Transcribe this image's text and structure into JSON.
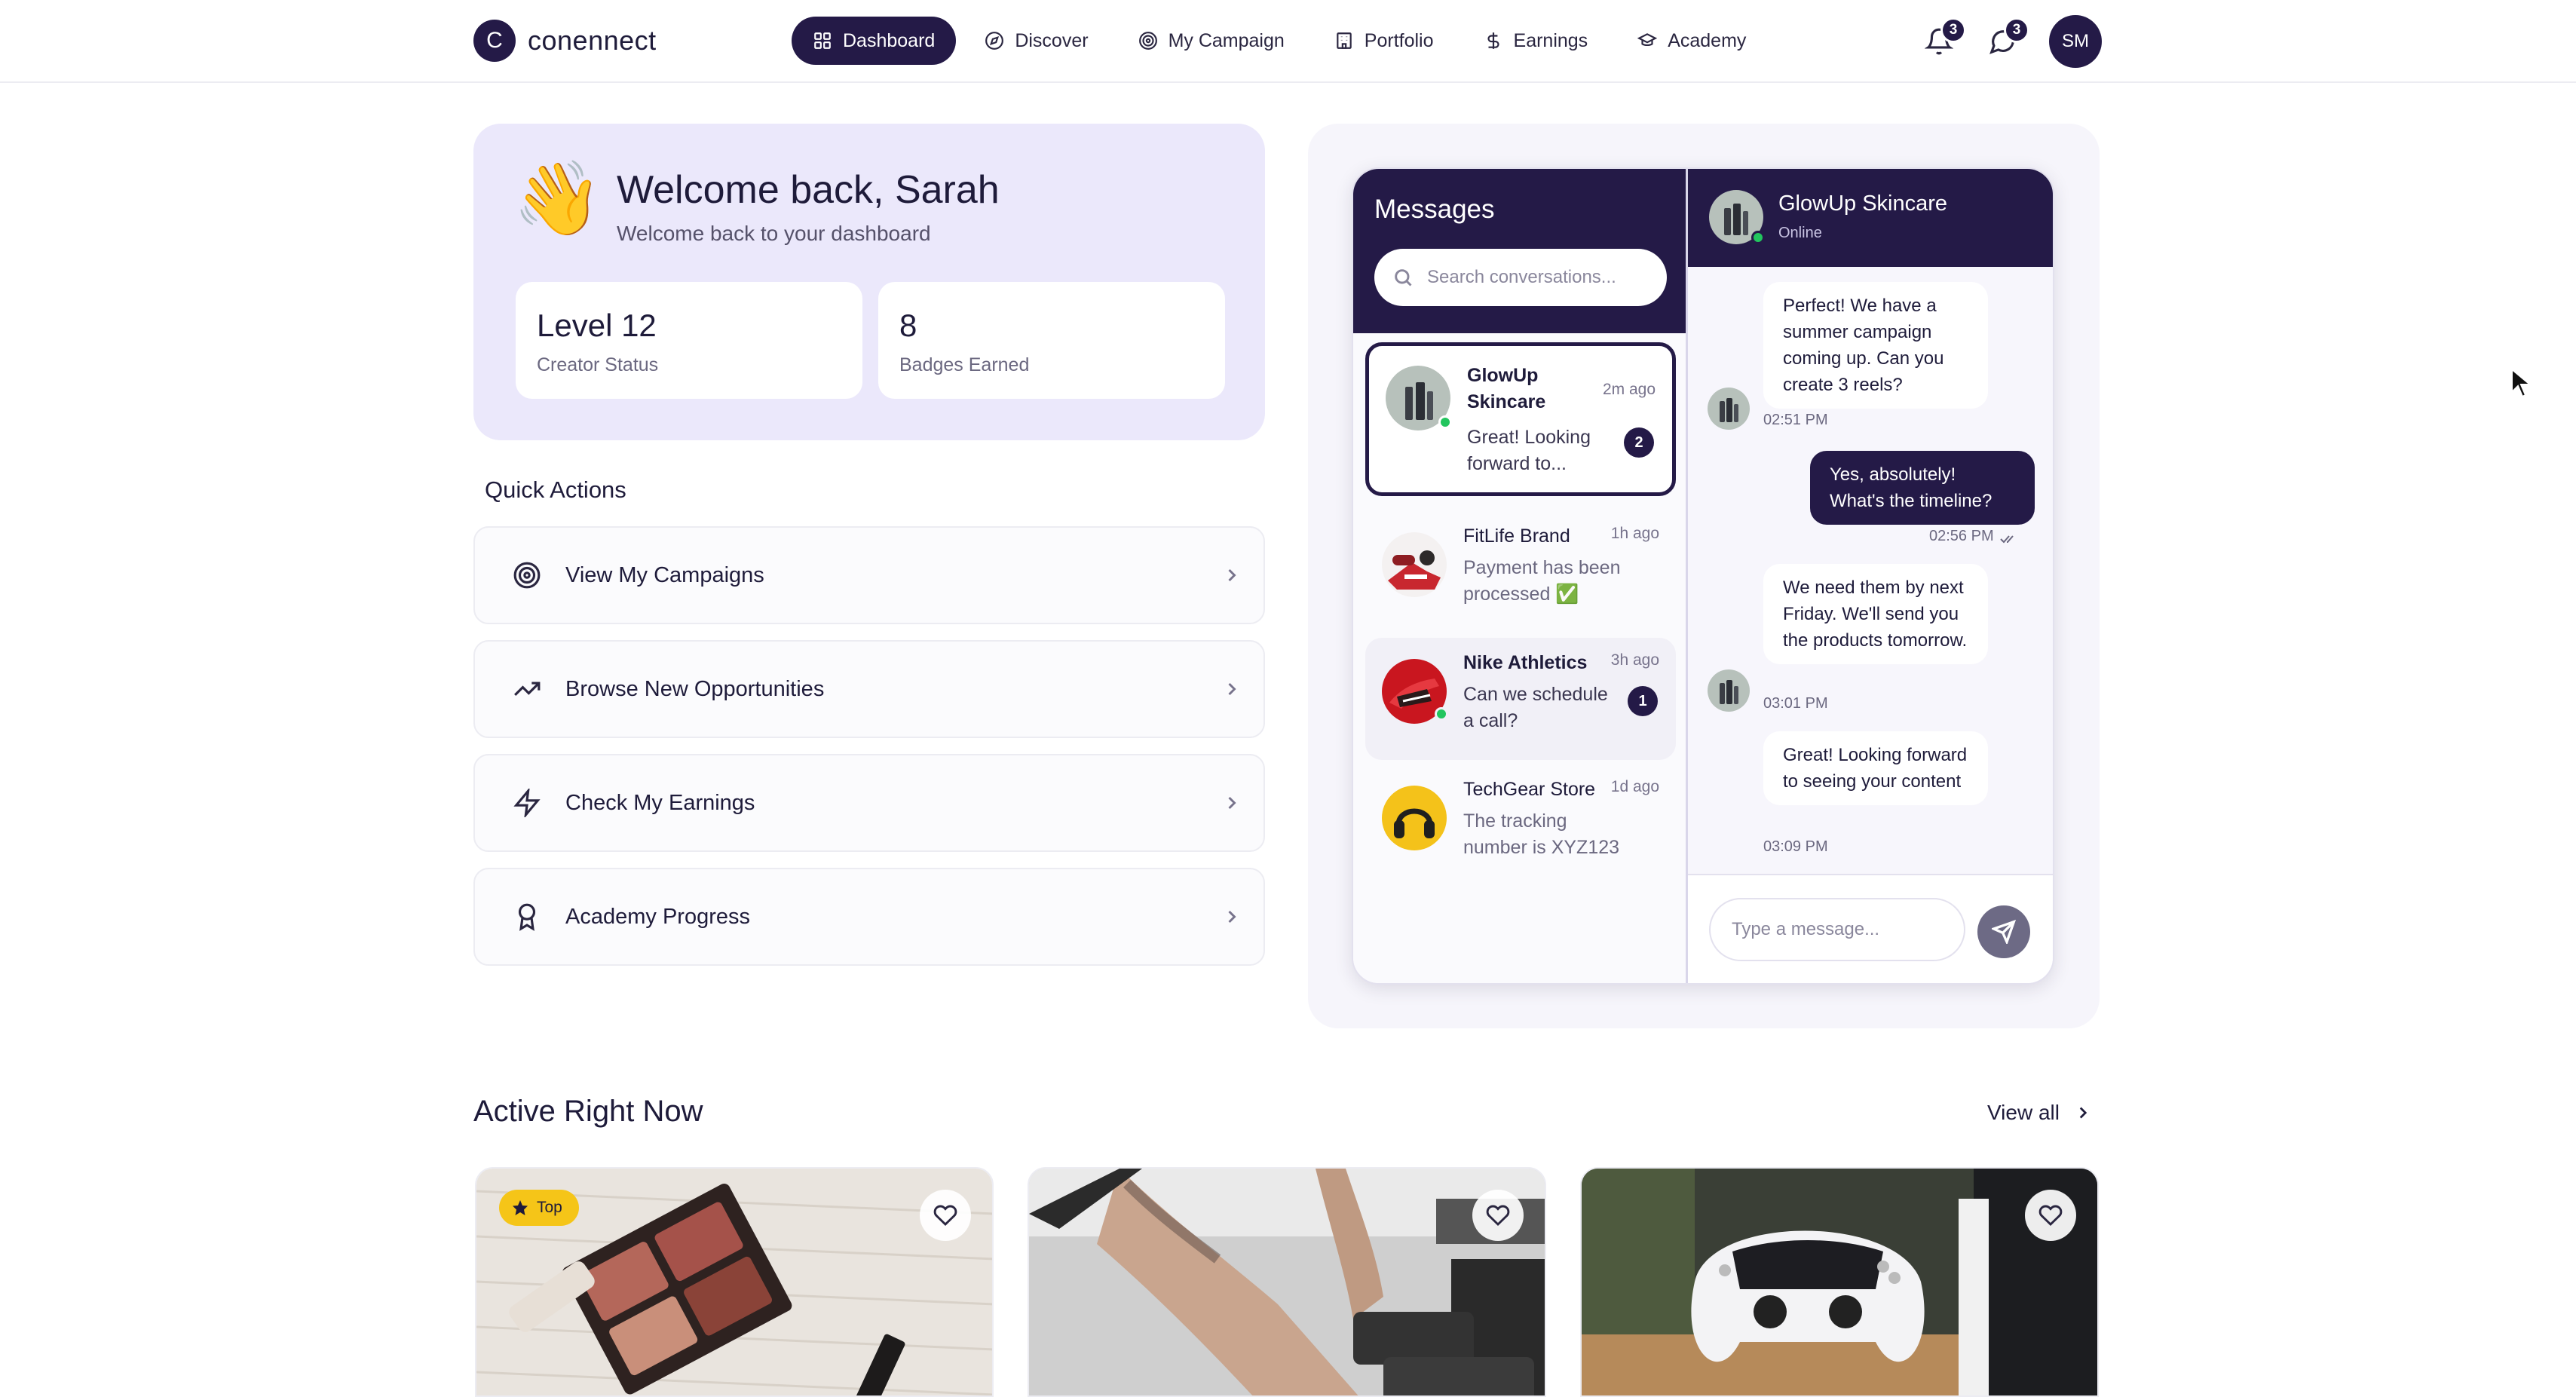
{
  "brand": {
    "logo_letter": "C",
    "name": "conennect"
  },
  "nav": {
    "items": [
      {
        "label": "Dashboard",
        "icon": "grid-icon",
        "active": true
      },
      {
        "label": "Discover",
        "icon": "compass-icon",
        "active": false
      },
      {
        "label": "My Campaign",
        "icon": "target-icon",
        "active": false
      },
      {
        "label": "Portfolio",
        "icon": "building-icon",
        "active": false
      },
      {
        "label": "Earnings",
        "icon": "dollar-icon",
        "active": false
      },
      {
        "label": "Academy",
        "icon": "graduation-cap-icon",
        "active": false
      }
    ],
    "notifications_count": "3",
    "messages_count": "3",
    "user_initials": "SM"
  },
  "welcome": {
    "emoji": "👋",
    "title": "Welcome back, Sarah",
    "subtitle": "Welcome back to your dashboard",
    "stats": [
      {
        "value": "Level 12",
        "label": "Creator Status"
      },
      {
        "value": "8",
        "label": "Badges Earned"
      }
    ]
  },
  "quick_actions": {
    "title": "Quick Actions",
    "items": [
      {
        "label": "View My Campaigns",
        "icon": "target-icon"
      },
      {
        "label": "Browse New Opportunities",
        "icon": "trending-up-icon"
      },
      {
        "label": "Check My Earnings",
        "icon": "zap-icon"
      },
      {
        "label": "Academy Progress",
        "icon": "award-icon"
      }
    ]
  },
  "messages": {
    "title": "Messages",
    "search_placeholder": "Search conversations...",
    "conversations": [
      {
        "name": "GlowUp Skincare",
        "time": "2m ago",
        "preview": "Great! Looking forward to...",
        "unread": "2",
        "online": true,
        "selected": true
      },
      {
        "name": "FitLife Brand",
        "time": "1h ago",
        "preview": "Payment has been processed ✅",
        "unread": "",
        "online": false,
        "selected": false
      },
      {
        "name": "Nike Athletics",
        "time": "3h ago",
        "preview": "Can we schedule a call?",
        "unread": "1",
        "online": true,
        "selected": false
      },
      {
        "name": "TechGear Store",
        "time": "1d ago",
        "preview": "The tracking number is XYZ123",
        "unread": "",
        "online": false,
        "selected": false
      }
    ],
    "chat": {
      "name": "GlowUp Skincare",
      "status": "Online",
      "messages": [
        {
          "from": "them",
          "text": "Perfect! We have a summer campaign coming up. Can you create 3 reels?",
          "time": "02:51 PM"
        },
        {
          "from": "me",
          "text": "Yes, absolutely! What's the timeline?",
          "time": "02:56 PM"
        },
        {
          "from": "them",
          "text": "We need them by next Friday. We'll send you the products tomorrow.",
          "time": "03:01 PM"
        },
        {
          "from": "them",
          "text": "Great! Looking forward to seeing your content",
          "time": "03:09 PM"
        }
      ],
      "composer_placeholder": "Type a message..."
    }
  },
  "active": {
    "title": "Active Right Now",
    "view_all": "View all",
    "cards": [
      {
        "badge": "Top",
        "image": "makeup-palette"
      },
      {
        "badge": "",
        "image": "gym-dumbbells"
      },
      {
        "badge": "",
        "image": "game-controller"
      }
    ]
  },
  "colors": {
    "brand_dark": "#241a47",
    "welcome_bg": "#ebe8fb",
    "online_green": "#22c55e",
    "top_badge": "#f5c518"
  }
}
